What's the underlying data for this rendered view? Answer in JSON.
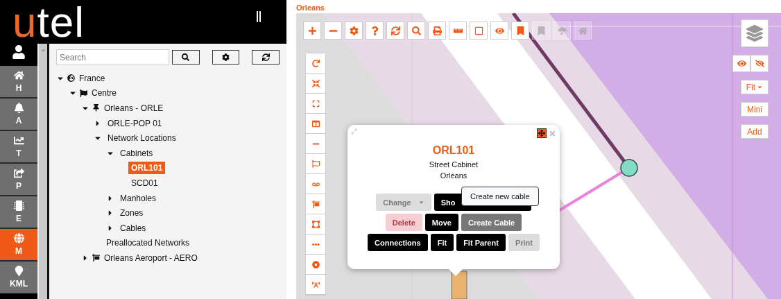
{
  "logo": {
    "first": "u",
    "rest": "tel"
  },
  "nav": [
    {
      "label": "H",
      "selected": false
    },
    {
      "label": "A",
      "selected": false
    },
    {
      "label": "T",
      "selected": false
    },
    {
      "label": "P",
      "selected": false
    },
    {
      "label": "E",
      "selected": false
    },
    {
      "label": "M",
      "selected": true
    },
    {
      "label": "KML",
      "selected": false
    }
  ],
  "search": {
    "placeholder": "Search"
  },
  "tree": [
    {
      "label": "France",
      "kind": "country",
      "expanded": true,
      "selected": false,
      "children": [
        {
          "label": "Centre",
          "kind": "region",
          "expanded": true,
          "selected": false,
          "children": [
            {
              "label": "Orleans - ORLE",
              "kind": "site",
              "expanded": true,
              "selected": false,
              "children": [
                {
                  "label": "ORLE-POP 01",
                  "expanded": false,
                  "selected": false
                },
                {
                  "label": "Network Locations",
                  "expanded": true,
                  "selected": false,
                  "children": [
                    {
                      "label": "Cabinets",
                      "expanded": true,
                      "selected": false,
                      "children": [
                        {
                          "label": "ORL101",
                          "selected": true
                        },
                        {
                          "label": "SCD01",
                          "selected": false
                        }
                      ]
                    },
                    {
                      "label": "Manholes",
                      "expanded": false,
                      "selected": false
                    },
                    {
                      "label": "Zones",
                      "expanded": false,
                      "selected": false
                    },
                    {
                      "label": "Cables",
                      "expanded": false,
                      "selected": false
                    }
                  ]
                },
                {
                  "label": "Preallocated Networks",
                  "selected": false
                }
              ]
            },
            {
              "label": "Orleans Aeroport - AERO",
              "kind": "station",
              "expanded": false,
              "selected": false
            }
          ]
        }
      ]
    }
  ],
  "map": {
    "title": "Orleans",
    "top_tools": [
      {
        "disabled": false
      },
      {
        "disabled": false
      },
      {
        "disabled": false
      },
      {
        "disabled": false
      },
      {
        "disabled": false
      },
      {
        "disabled": false
      },
      {
        "disabled": false
      },
      {
        "disabled": false
      },
      {
        "disabled": false
      },
      {
        "disabled": false
      },
      {
        "disabled": false
      },
      {
        "disabled": true
      },
      {
        "disabled": true
      },
      {
        "disabled": true
      }
    ],
    "fit": {
      "label": "Fit"
    },
    "side_buttons": [
      "Mini",
      "Add"
    ],
    "popup": {
      "title": "ORL101",
      "type": "Street Cabinet",
      "place": "Orleans",
      "rows": [
        [
          {
            "label": "Change",
            "kind": "muted",
            "dropdown": true
          },
          {
            "label": "Sho",
            "kind": "dark",
            "dropdown": false
          }
        ],
        [
          {
            "label": "Delete",
            "kind": "danger",
            "dropdown": false
          },
          {
            "label": "Move",
            "kind": "dark",
            "dropdown": false
          },
          {
            "label": "Create Cable",
            "kind": "hover",
            "dropdown": false
          }
        ],
        [
          {
            "label": "Connections",
            "kind": "dark",
            "dropdown": false
          },
          {
            "label": "Fit",
            "kind": "dark",
            "dropdown": false
          },
          {
            "label": "Fit Parent",
            "kind": "dark",
            "dropdown": false
          },
          {
            "label": "Print",
            "kind": "muted",
            "dropdown": false
          }
        ]
      ],
      "tooltip": "Create new cable"
    }
  }
}
